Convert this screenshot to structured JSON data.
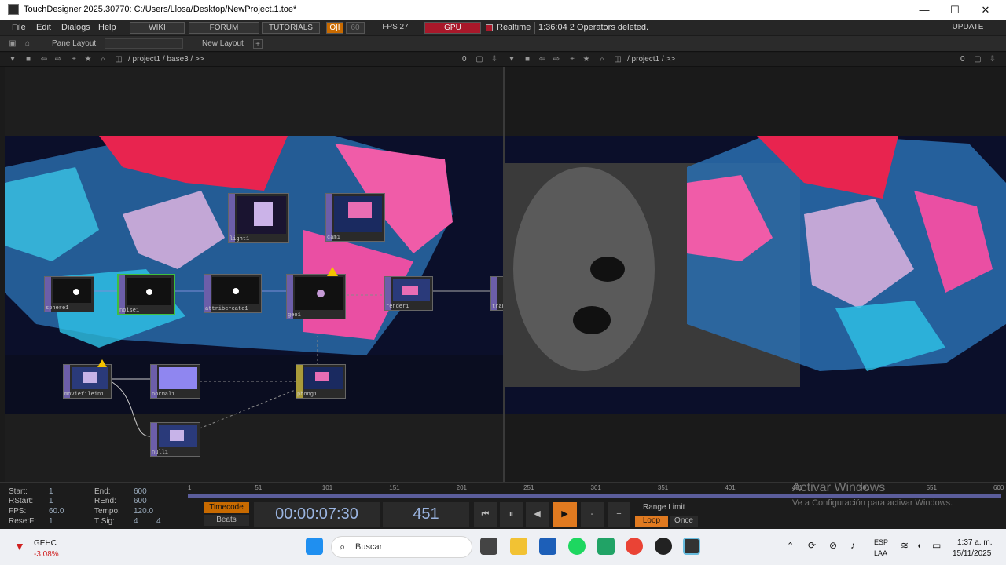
{
  "title": "TouchDesigner 2025.30770: C:/Users/Llosa/Desktop/NewProject.1.toe*",
  "menu": [
    "File",
    "Edit",
    "Dialogs",
    "Help"
  ],
  "toolbar": {
    "wiki": "WIKI",
    "forum": "FORUM",
    "tutorials": "TUTORIALS",
    "oi": "O|I",
    "sixty": "60",
    "fps": "FPS  27",
    "gpu": "GPU",
    "realtime": "Realtime",
    "status": "1:36:04 2 Operators deleted.",
    "update": "UPDATE"
  },
  "pane": {
    "pane_layout": "Pane Layout",
    "new_layout": "New Layout",
    "plus": "+"
  },
  "left_path": "/ project1 / base3 / >>",
  "right_path": "/ project1 / >>",
  "left_count": "0",
  "right_count": "0",
  "nodes": {
    "sphere": "sphere1",
    "noise": "noise1",
    "attr": "attribcreate1",
    "geo": "geo1",
    "light": "light1",
    "cam": "cam1",
    "render": "render1",
    "tran": "tran",
    "movie": "moviefilein1",
    "normal": "normal1",
    "phong": "phong1",
    "null": "null1"
  },
  "bottom": {
    "start_l": "Start:",
    "start": "1",
    "rstart_l": "RStart:",
    "rstart": "1",
    "fps_l": "FPS:",
    "fps": "60.0",
    "resetf_l": "ResetF:",
    "resetf": "1",
    "end_l": "End:",
    "end": "600",
    "rend_l": "REnd:",
    "rend": "600",
    "tempo_l": "Tempo:",
    "tempo": "120.0",
    "tsig_l": "T Sig:",
    "tsig1": "4",
    "tsig2": "4",
    "timecode": "Timecode",
    "beats": "Beats",
    "time": "00:00:07:30",
    "frame": "451",
    "minus": "-",
    "plus": "+",
    "range": "Range Limit",
    "loop": "Loop",
    "once": "Once"
  },
  "ruler": [
    "1",
    "51",
    "101",
    "151",
    "201",
    "251",
    "301",
    "351",
    "401",
    "451",
    "501",
    "551",
    "600"
  ],
  "watermark": {
    "line1": "Activar Windows",
    "line2": "Ve a Configuración para activar Windows."
  },
  "taskbar": {
    "stock": "GEHC",
    "pct": "-3.08%",
    "search": "Buscar",
    "lang1": "ESP",
    "lang2": "LAA",
    "time": "1:37 a. m.",
    "date": "15/11/2025"
  },
  "colors": {
    "gpu": "#a8182a",
    "oi": "#c86a00",
    "play": "#e07a20",
    "loop": "#e07a20",
    "accent": "#5b5d9b"
  }
}
